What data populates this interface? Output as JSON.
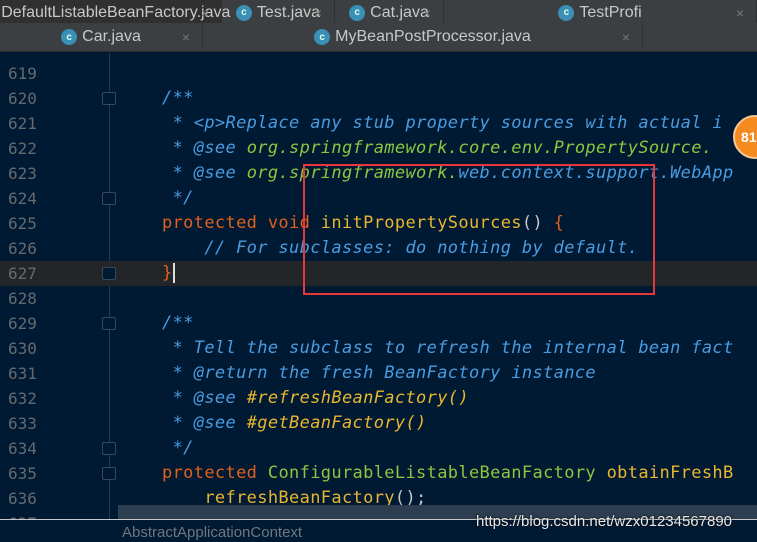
{
  "tabs_row1": [
    {
      "label": "DefaultListableBeanFactory.java",
      "active": true
    },
    {
      "label": "Test.java"
    },
    {
      "label": "Cat.java"
    },
    {
      "label": "TestProfi"
    }
  ],
  "tabs_row2": [
    {
      "label": "Car.java"
    },
    {
      "label": "MyBeanPostProcessor.java"
    }
  ],
  "close_glyph": "×",
  "class_icon_glyph": "c",
  "badge": "81",
  "lines": [
    {
      "n": "619",
      "tokens": []
    },
    {
      "n": "620",
      "fold": true,
      "tokens": [
        {
          "c": "cm",
          "t": "/**"
        }
      ]
    },
    {
      "n": "621",
      "tokens": [
        {
          "c": "cm",
          "t": " * <p>Replace any stub property sources with actual i"
        }
      ]
    },
    {
      "n": "622",
      "tokens": [
        {
          "c": "cm",
          "t": " * @see "
        },
        {
          "c": "gri",
          "t": "org.springframework.core.env.PropertySource."
        }
      ]
    },
    {
      "n": "623",
      "tokens": [
        {
          "c": "cm",
          "t": " * @see "
        },
        {
          "c": "gri",
          "t": "org.springframework."
        },
        {
          "c": "cm",
          "t": "web.context.support.WebApp"
        }
      ]
    },
    {
      "n": "624",
      "fold": true,
      "tokens": [
        {
          "c": "cm",
          "t": " */"
        }
      ]
    },
    {
      "n": "625",
      "tokens": [
        {
          "c": "kw",
          "t": "protected void "
        },
        {
          "c": "fn",
          "t": "initPropertySources"
        },
        {
          "c": "pl",
          "t": "() "
        },
        {
          "c": "kw",
          "t": "{"
        }
      ]
    },
    {
      "n": "626",
      "tokens": [
        {
          "c": "cm",
          "t": "    // For subclasses: do nothing by default."
        }
      ]
    },
    {
      "n": "627",
      "fold": true,
      "current": true,
      "tokens": [
        {
          "c": "kw",
          "t": "}"
        }
      ]
    },
    {
      "n": "628",
      "tokens": []
    },
    {
      "n": "629",
      "fold": true,
      "tokens": [
        {
          "c": "cm",
          "t": "/**"
        }
      ]
    },
    {
      "n": "630",
      "tokens": [
        {
          "c": "cm",
          "t": " * Tell the subclass to refresh the internal bean fact"
        }
      ]
    },
    {
      "n": "631",
      "tokens": [
        {
          "c": "cm",
          "t": " * @return the fresh BeanFactory instance"
        }
      ]
    },
    {
      "n": "632",
      "tokens": [
        {
          "c": "cm",
          "t": " * @see "
        },
        {
          "c": "yi",
          "t": "#refreshBeanFactory()"
        }
      ]
    },
    {
      "n": "633",
      "tokens": [
        {
          "c": "cm",
          "t": " * @see "
        },
        {
          "c": "yi",
          "t": "#getBeanFactory()"
        }
      ]
    },
    {
      "n": "634",
      "fold": true,
      "tokens": [
        {
          "c": "cm",
          "t": " */"
        }
      ]
    },
    {
      "n": "635",
      "fold": true,
      "tokens": [
        {
          "c": "kw",
          "t": "protected "
        },
        {
          "c": "gr",
          "t": "ConfigurableListableBeanFactory "
        },
        {
          "c": "fn",
          "t": "obtainFreshB"
        }
      ]
    },
    {
      "n": "636",
      "tokens": [
        {
          "c": "fn",
          "t": "    refreshBeanFactory"
        },
        {
          "c": "pl",
          "t": "();"
        }
      ]
    },
    {
      "n": "637",
      "tokens": []
    }
  ],
  "breadcrumb": "AbstractApplicationContext",
  "watermark": "https://blog.csdn.net/wzx01234567890"
}
